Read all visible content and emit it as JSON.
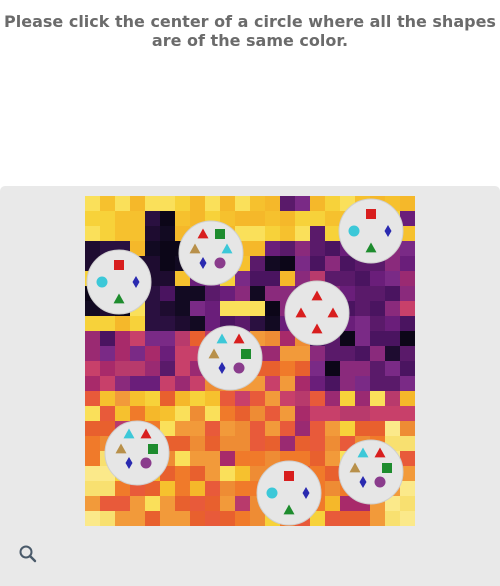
{
  "instruction": {
    "line1": "Please click the center of a circle where all the shapes",
    "line2": "are of the same color."
  },
  "colors": {
    "instruction_text": "#6b6b6b",
    "panel_bg": "#e9e9e9",
    "circle_fill": "#e6e6e6",
    "red": "#d81e1e",
    "cyan": "#3cc8d8",
    "blue": "#2a2ab0",
    "green": "#1e8c2e",
    "purple": "#8a3c8c",
    "tan": "#b8904a",
    "search_icon": "#4a5a6a"
  },
  "circles": [
    {
      "id": "circle-1",
      "shapes": [
        "red triangle",
        "green square",
        "tan triangle",
        "cyan triangle",
        "blue diamond",
        "purple circle"
      ]
    },
    {
      "id": "circle-2",
      "shapes": [
        "red square",
        "cyan circle",
        "blue diamond",
        "green triangle"
      ]
    },
    {
      "id": "circle-3",
      "shapes": [
        "red square",
        "cyan circle",
        "blue diamond",
        "green triangle"
      ]
    },
    {
      "id": "circle-4",
      "shapes": [
        "red triangle",
        "red triangle",
        "red triangle",
        "red triangle"
      ]
    },
    {
      "id": "circle-5",
      "shapes": [
        "cyan triangle",
        "red triangle",
        "tan triangle",
        "green square",
        "blue diamond",
        "purple circle"
      ]
    },
    {
      "id": "circle-6",
      "shapes": [
        "cyan triangle",
        "red triangle",
        "tan triangle",
        "green square",
        "blue diamond",
        "purple circle"
      ]
    },
    {
      "id": "circle-7",
      "shapes": [
        "cyan triangle",
        "red triangle",
        "tan triangle",
        "green square",
        "blue diamond",
        "purple circle"
      ]
    },
    {
      "id": "circle-8",
      "shapes": [
        "red square",
        "cyan circle",
        "blue diamond",
        "green triangle"
      ]
    }
  ],
  "search_icon": "search-icon"
}
